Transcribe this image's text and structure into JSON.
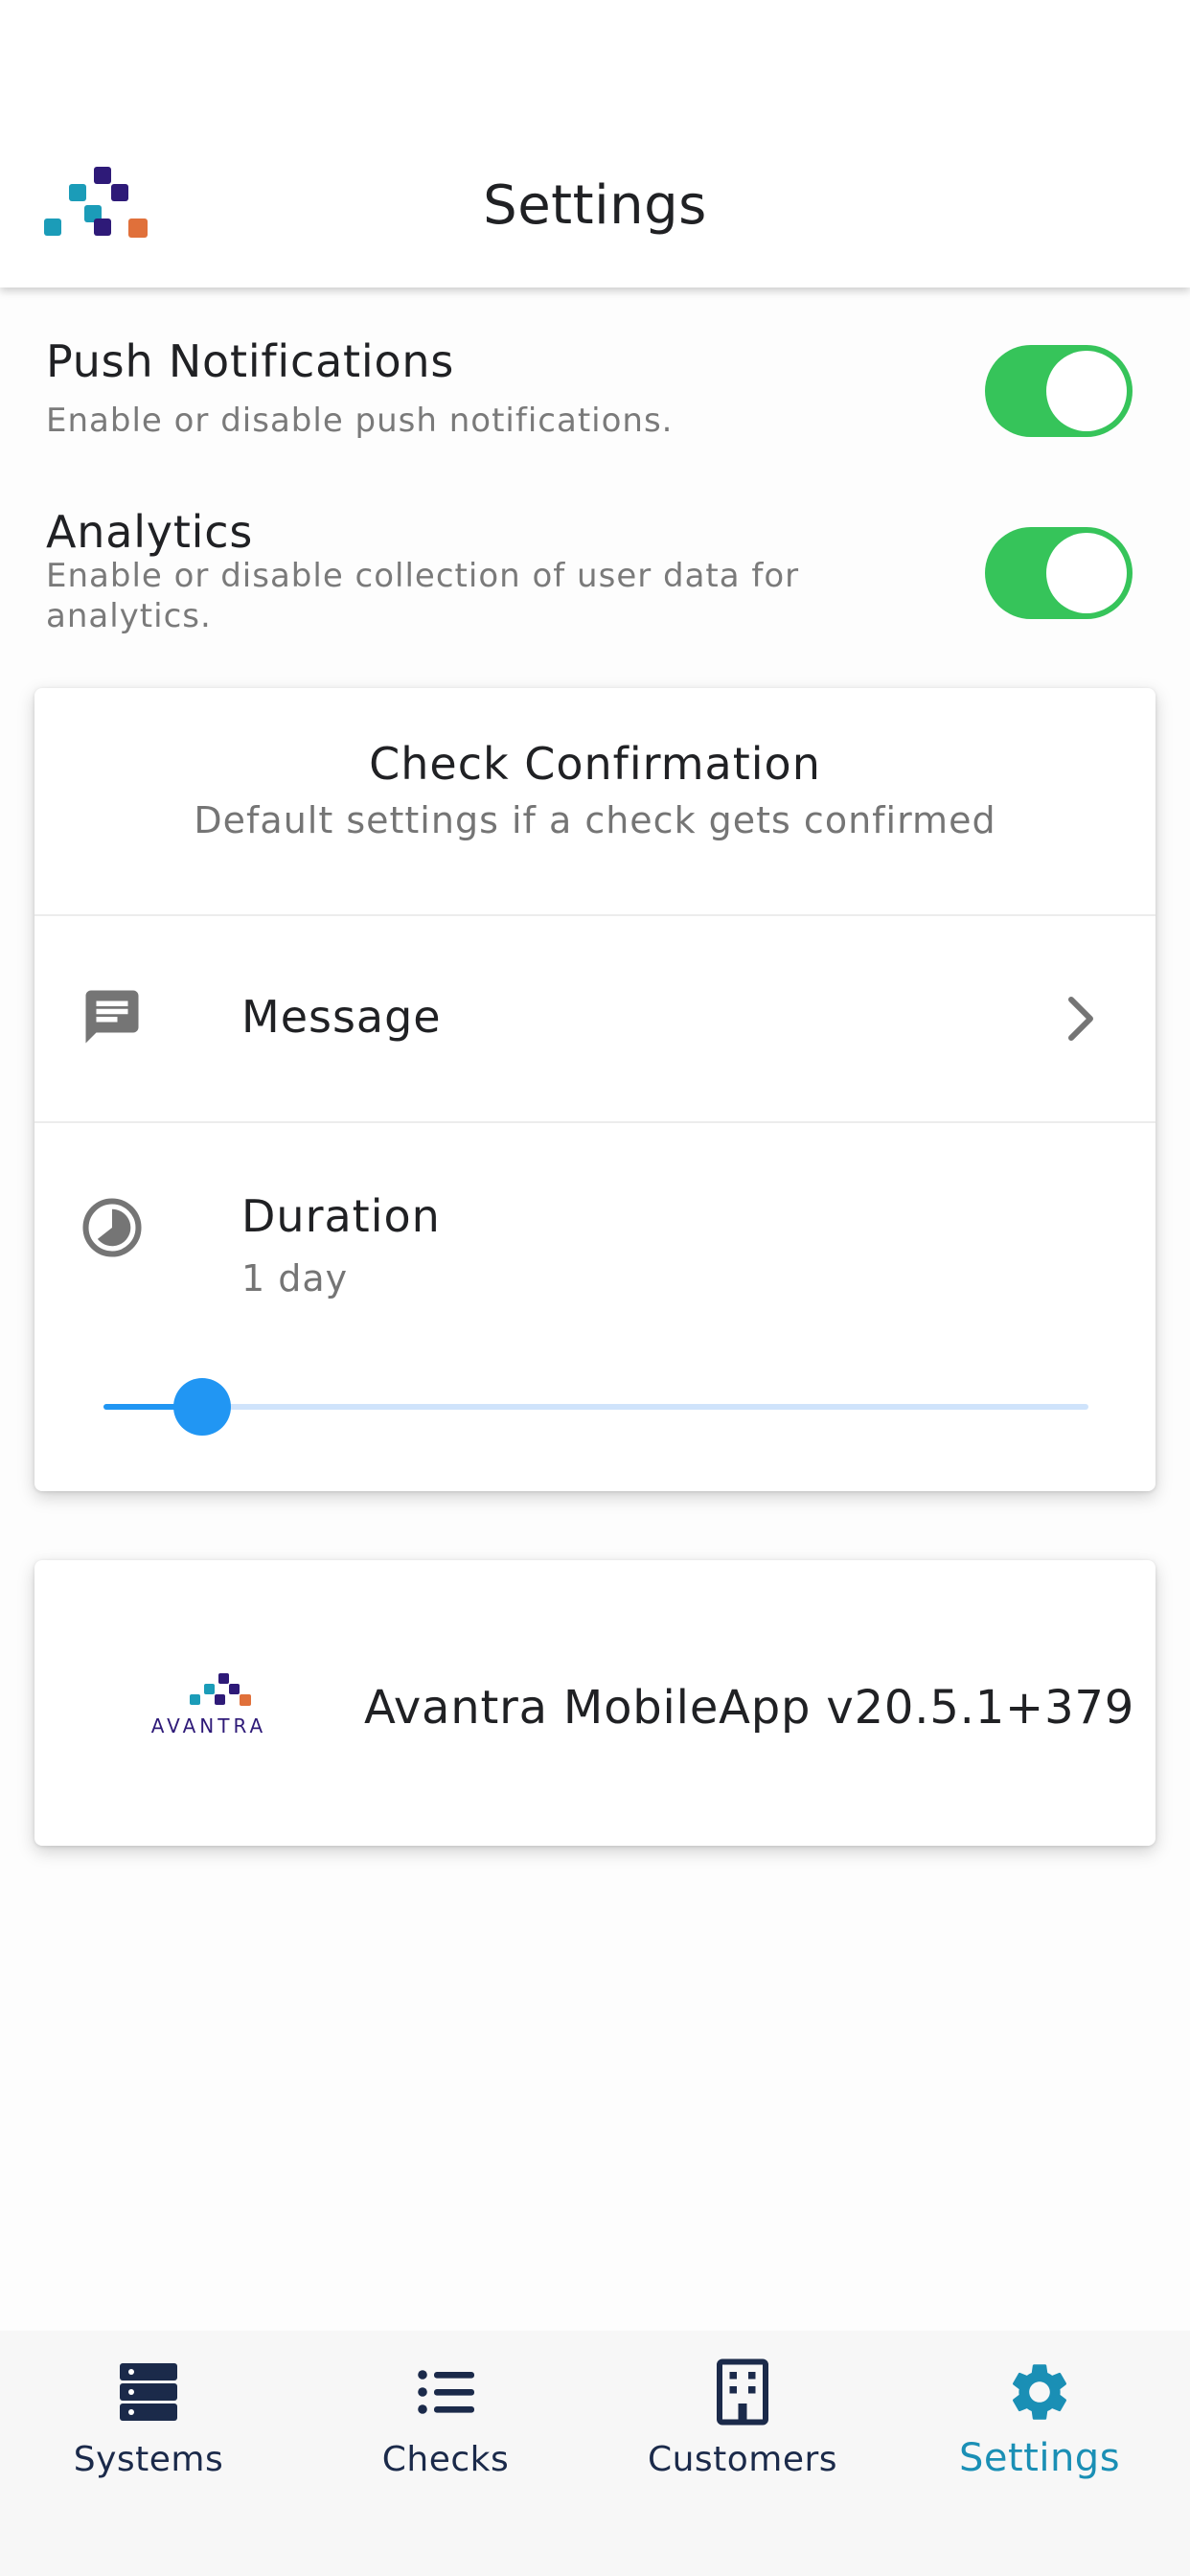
{
  "header": {
    "title": "Settings",
    "brand_colors": {
      "teal": "#1b9cb8",
      "purple": "#2e1a78",
      "orange": "#e0703a"
    }
  },
  "settings": {
    "push": {
      "title": "Push Notifications",
      "description": "Enable or disable push notifications.",
      "enabled": true
    },
    "analytics": {
      "title": "Analytics",
      "description_line1": "Enable or disable collection of user data for",
      "description_line2": "analytics.",
      "enabled": true
    }
  },
  "check_confirmation": {
    "title": "Check Confirmation",
    "subtitle": "Default settings if a check gets confirmed",
    "message": {
      "label": "Message",
      "icon": "message-icon"
    },
    "duration": {
      "label": "Duration",
      "value": "1 day",
      "icon": "duration-icon",
      "slider_fraction": 0.1
    }
  },
  "about": {
    "logo_text": "AVANTRA",
    "version_text": "Avantra MobileApp v20.5.1+379"
  },
  "nav": {
    "items": [
      {
        "label": "Systems",
        "icon": "server-icon",
        "active": false
      },
      {
        "label": "Checks",
        "icon": "list-icon",
        "active": false
      },
      {
        "label": "Customers",
        "icon": "building-icon",
        "active": false
      },
      {
        "label": "Settings",
        "icon": "gear-icon",
        "active": true
      }
    ],
    "active_color": "#1a8fb5",
    "inactive_color": "#1b2a4a"
  },
  "colors": {
    "toggle_on": "#36c45a",
    "slider_accent": "#2196f3"
  }
}
